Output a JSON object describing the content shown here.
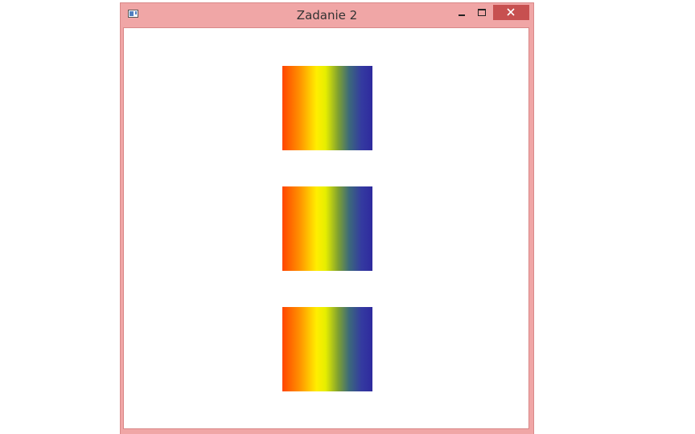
{
  "window": {
    "title": "Zadanie 2",
    "icon": "app-window-icon",
    "controls": {
      "minimize": "minimize-icon",
      "maximize": "maximize-icon",
      "close": "close-icon"
    },
    "frame_color": "#f0a6a6",
    "close_button_color": "#c75050"
  },
  "content": {
    "rectangles": [
      {
        "fill": "linear-gradient",
        "colors": [
          "#ff4500",
          "#ff9500",
          "#ffee00",
          "#7fa030",
          "#3c6a7a",
          "#2e2a9e"
        ]
      },
      {
        "fill": "linear-gradient",
        "colors": [
          "#ff4500",
          "#ff9500",
          "#ffee00",
          "#7fa030",
          "#3c6a7a",
          "#2e2a9e"
        ]
      },
      {
        "fill": "linear-gradient",
        "colors": [
          "#ff4500",
          "#ff9500",
          "#ffee00",
          "#7fa030",
          "#3c6a7a",
          "#2e2a9e"
        ]
      }
    ]
  }
}
